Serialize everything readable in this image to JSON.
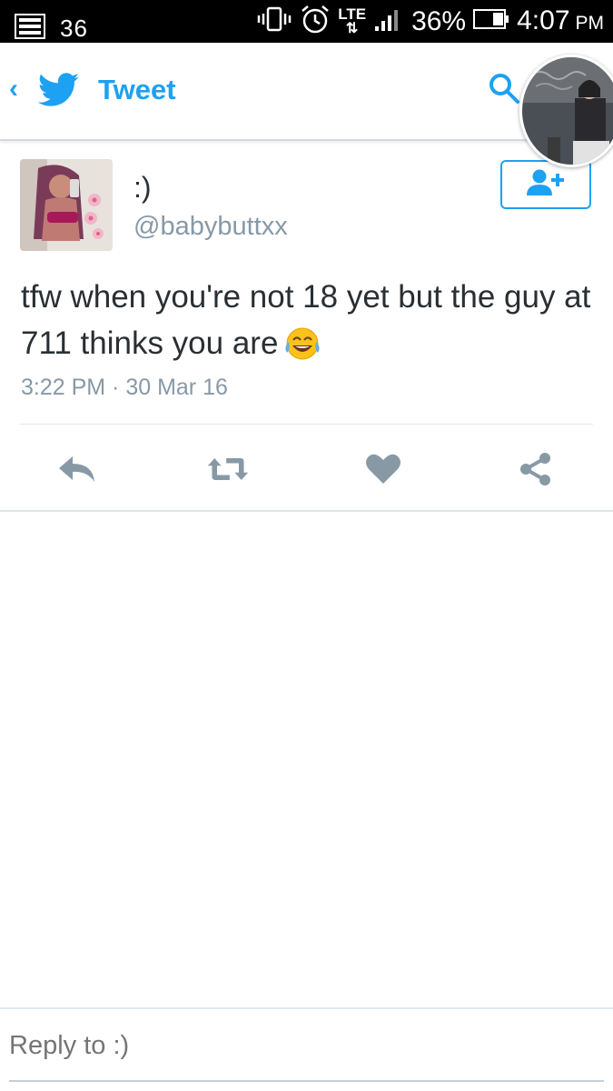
{
  "status_bar": {
    "notification_text": "36",
    "network": "LTE",
    "battery_percent": "36%",
    "time": "4:07",
    "time_suffix": "PM"
  },
  "header": {
    "back_symbol": "‹",
    "title": "Tweet",
    "icons": [
      "back-chevron-icon",
      "twitter-bird-icon",
      "search-icon",
      "profile-avatar"
    ]
  },
  "tweet": {
    "display_name": ":)",
    "handle": "@babybuttxx",
    "text": "tfw when you're not 18 yet but the guy at 711 thinks you are",
    "emoji": "face-with-tears-of-joy",
    "timestamp": "3:22 PM · 30 Mar 16",
    "actions": [
      "reply-icon",
      "retweet-icon",
      "like-icon",
      "share-icon"
    ]
  },
  "reply": {
    "placeholder": "Reply to :)"
  },
  "colors": {
    "twitter_blue": "#1da1f2",
    "muted_text": "#8899a6",
    "action_gray": "#8899a6",
    "divider": "#e1e8ed"
  }
}
